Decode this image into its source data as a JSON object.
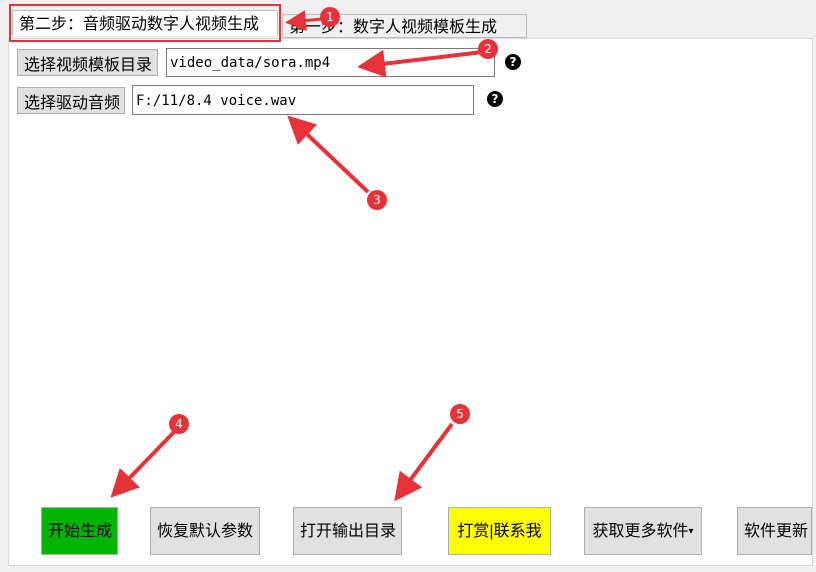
{
  "tabs": [
    {
      "label": "第二步：音频驱动数字人视频生成",
      "active": true
    },
    {
      "label": "第一步：数字人视频模板生成",
      "active": false
    }
  ],
  "video_template": {
    "button_label": "选择视频模板目录",
    "value": "video_data/sora.mp4"
  },
  "audio": {
    "button_label": "选择驱动音频",
    "value": "F:/11/8.4 voice.wav"
  },
  "help_glyph": "?",
  "actions": {
    "start": "开始生成",
    "reset": "恢复默认参数",
    "open_output": "打开输出目录",
    "donate": "打赏|联系我",
    "more": "获取更多软件",
    "update": "软件更新"
  },
  "annotations": [
    "1",
    "2",
    "3",
    "4",
    "5"
  ],
  "colors": {
    "start_button": "#00b400",
    "donate_button": "#ffff00",
    "annotation": "#e8323a"
  }
}
